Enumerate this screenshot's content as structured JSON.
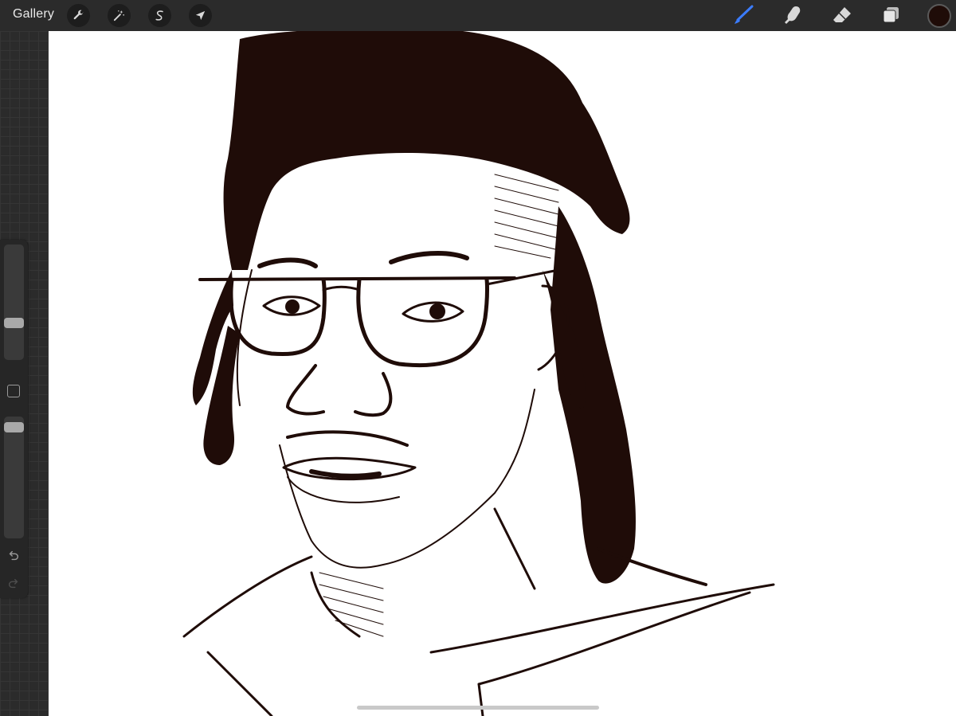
{
  "toolbar": {
    "gallery_label": "Gallery",
    "left_tools": [
      {
        "name": "actions",
        "icon": "wrench-icon"
      },
      {
        "name": "adjustments",
        "icon": "magic-wand-icon"
      },
      {
        "name": "selection",
        "icon": "selection-s-icon"
      },
      {
        "name": "transform",
        "icon": "transform-arrow-icon"
      }
    ],
    "right_tools": [
      {
        "name": "brush",
        "icon": "brush-icon",
        "active": true
      },
      {
        "name": "smudge",
        "icon": "smudge-finger-icon",
        "active": false
      },
      {
        "name": "eraser",
        "icon": "eraser-icon",
        "active": false
      },
      {
        "name": "layers",
        "icon": "layers-icon",
        "active": false
      }
    ],
    "current_color": "#1f0c08",
    "active_tool_color": "#3b7cff"
  },
  "sidebar": {
    "brush_size": 0.3,
    "brush_opacity": 0.95,
    "modify_button_icon": "square-icon",
    "undo_icon": "undo-icon",
    "redo_icon": "redo-icon"
  },
  "canvas": {
    "background": "#ffffff",
    "ink_color": "#1f0c08",
    "artwork": "sketch-portrait"
  }
}
